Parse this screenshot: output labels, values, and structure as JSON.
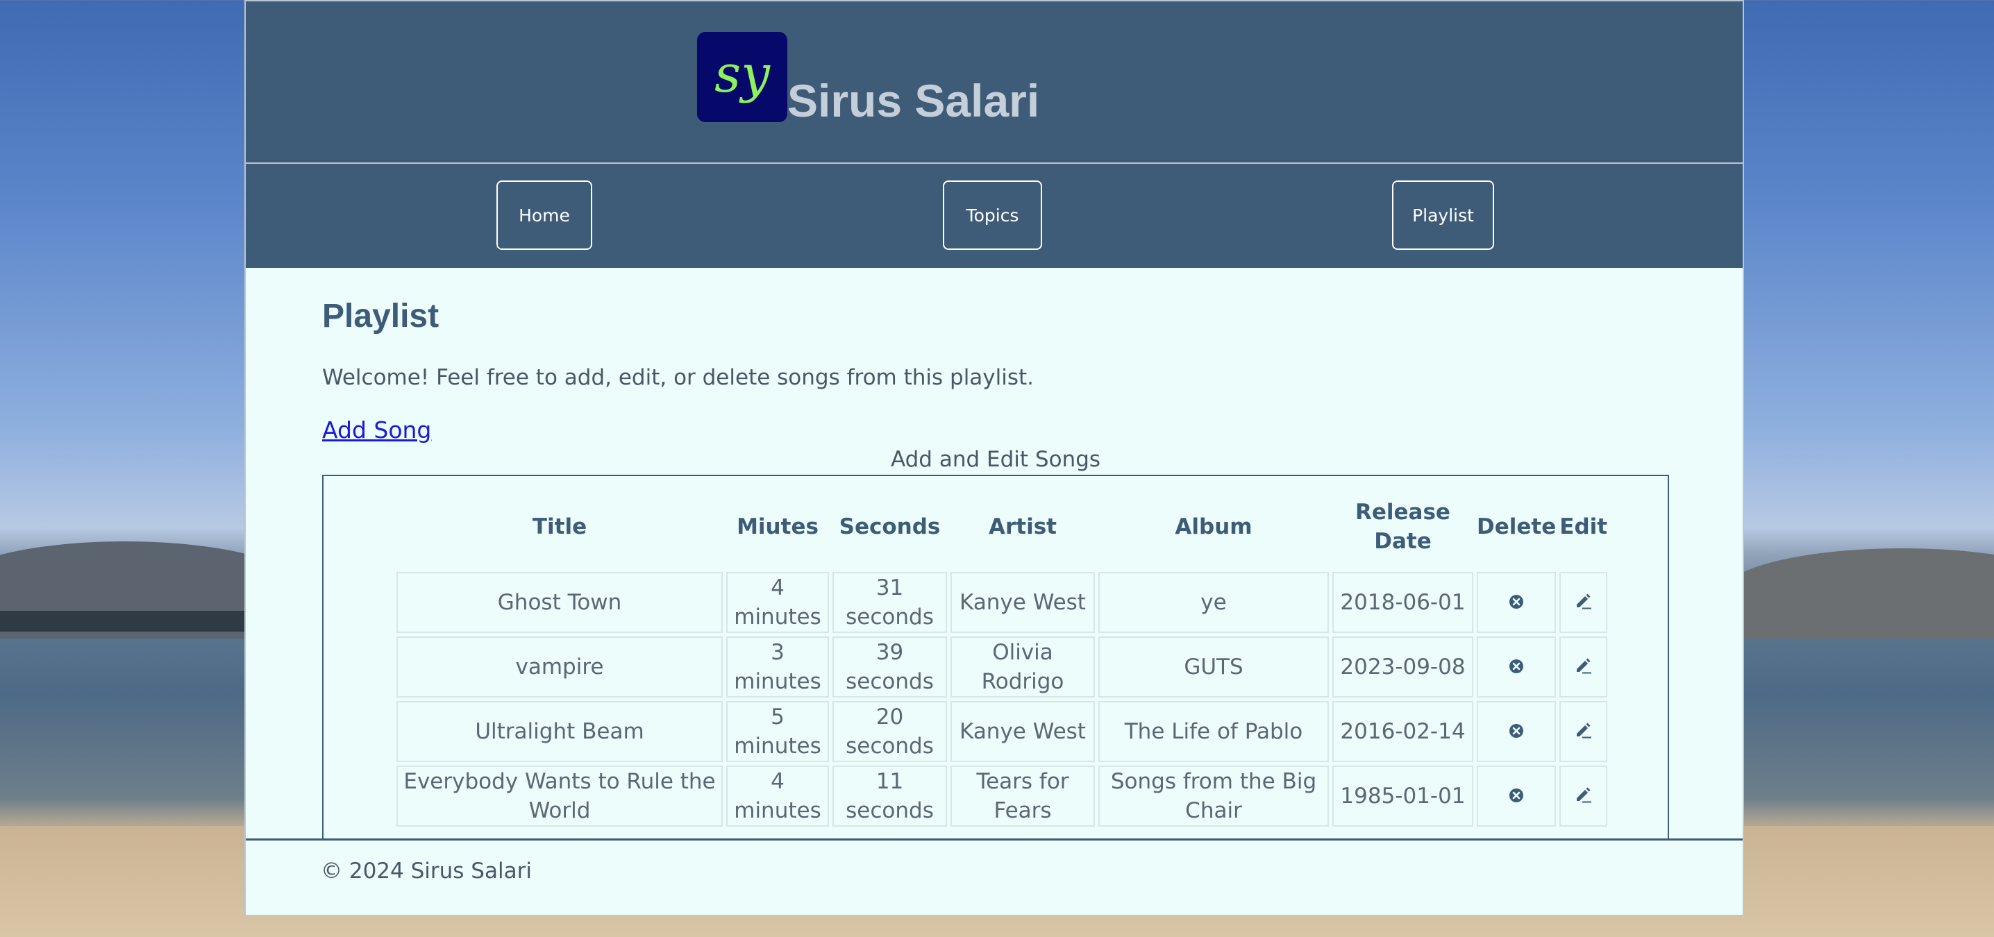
{
  "header": {
    "logo_text": "sy",
    "site_title": "Sirus Salari"
  },
  "nav": {
    "home": "Home",
    "topics": "Topics",
    "playlist": "Playlist"
  },
  "main": {
    "title": "Playlist",
    "welcome": "Welcome! Feel free to add, edit, or delete songs from this playlist.",
    "add_song_link": "Add Song",
    "table_caption": "Add and Edit Songs",
    "columns": [
      "Title",
      "Miutes",
      "Seconds",
      "Artist",
      "Album",
      "Release Date",
      "Delete",
      "Edit"
    ],
    "rows": [
      {
        "title": "Ghost Town",
        "minutes": "4 minutes",
        "seconds": "31 seconds",
        "artist": "Kanye West",
        "album": "ye",
        "release_date": "2018-06-01"
      },
      {
        "title": "vampire",
        "minutes": "3 minutes",
        "seconds": "39 seconds",
        "artist": "Olivia Rodrigo",
        "album": "GUTS",
        "release_date": "2023-09-08"
      },
      {
        "title": "Ultralight Beam",
        "minutes": "5 minutes",
        "seconds": "20 seconds",
        "artist": "Kanye West",
        "album": "The Life of Pablo",
        "release_date": "2016-02-14"
      },
      {
        "title": "Everybody Wants to Rule the World",
        "minutes": "4 minutes",
        "seconds": "11 seconds",
        "artist": "Tears for Fears",
        "album": "Songs from the Big Chair",
        "release_date": "1985-01-01"
      }
    ]
  },
  "footer": {
    "copyright": "© 2024 Sirus Salari"
  },
  "icons": {
    "delete": "close-circle-icon",
    "edit": "pencil-icon"
  },
  "colors": {
    "header_bg": "#3e5c78",
    "page_bg": "#ecfdfc",
    "logo_bg": "#06086a",
    "logo_fg": "#8df25e",
    "link": "#1a1ad6"
  }
}
